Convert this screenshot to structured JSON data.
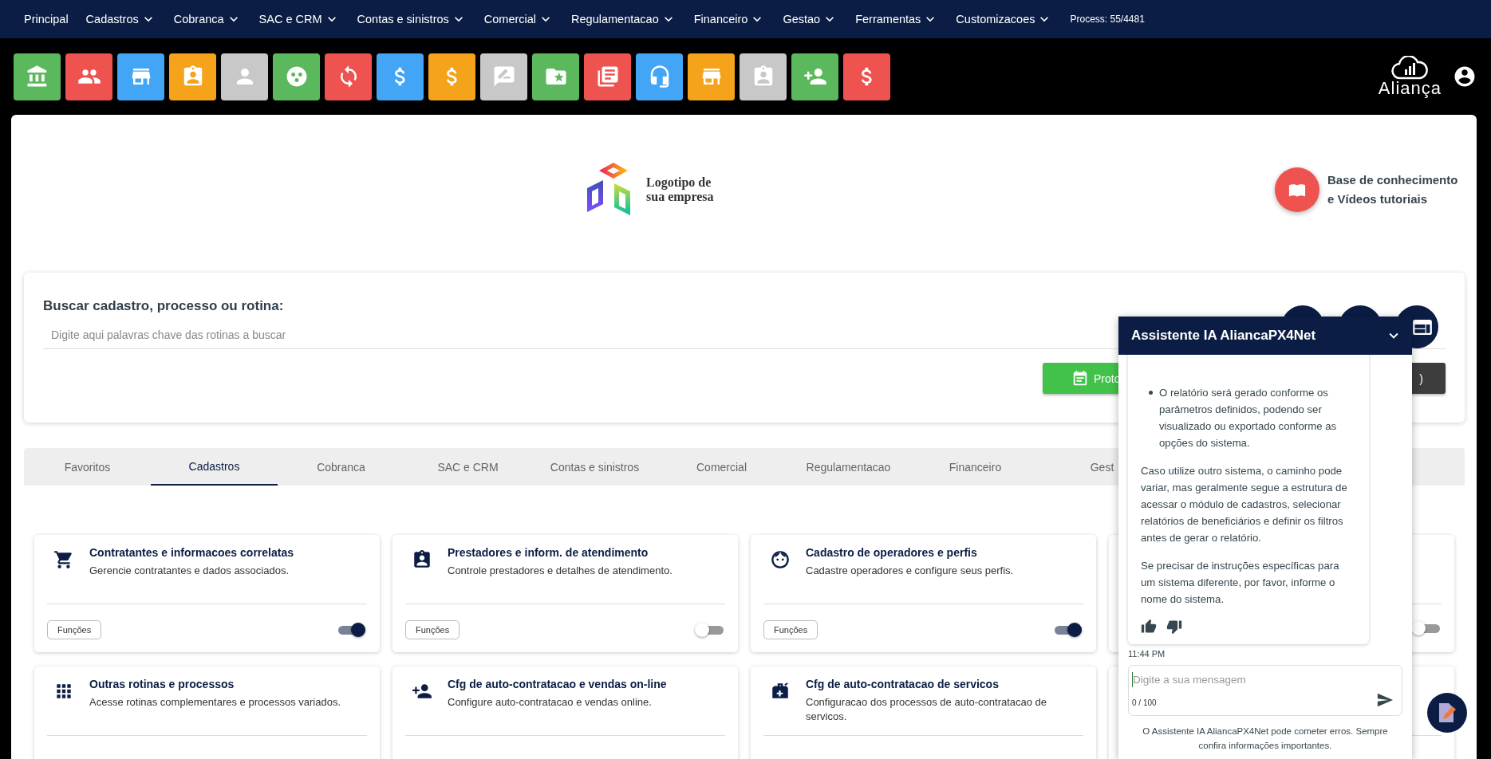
{
  "top_nav": {
    "items": [
      {
        "label": "Principal",
        "dropdown": false
      },
      {
        "label": "Cadastros",
        "dropdown": true
      },
      {
        "label": "Cobranca",
        "dropdown": true
      },
      {
        "label": "SAC e CRM",
        "dropdown": true
      },
      {
        "label": "Contas e sinistros",
        "dropdown": true
      },
      {
        "label": "Comercial",
        "dropdown": true
      },
      {
        "label": "Regulamentacao",
        "dropdown": true
      },
      {
        "label": "Financeiro",
        "dropdown": true
      },
      {
        "label": "Gestao",
        "dropdown": true
      },
      {
        "label": "Ferramentas",
        "dropdown": true
      },
      {
        "label": "Customizacoes",
        "dropdown": true
      }
    ],
    "process": "Process: 55/4481"
  },
  "shortcuts": [
    {
      "color": "#5cb85c"
    },
    {
      "color": "#ef5350"
    },
    {
      "color": "#42a5f5"
    },
    {
      "color": "#f5a31a"
    },
    {
      "color": "#c8c8c8"
    },
    {
      "color": "#5cb85c"
    },
    {
      "color": "#ef5350"
    },
    {
      "color": "#42a5f5"
    },
    {
      "color": "#f5a31a"
    },
    {
      "color": "#c8c8c8"
    },
    {
      "color": "#5cb85c"
    },
    {
      "color": "#ef5350"
    },
    {
      "color": "#42a5f5"
    },
    {
      "color": "#f5a31a"
    },
    {
      "color": "#c8c8c8"
    },
    {
      "color": "#5cb85c"
    },
    {
      "color": "#ef5350"
    }
  ],
  "brand": {
    "name": "Aliança"
  },
  "logo": {
    "text": "Logotipo de sua empresa"
  },
  "knowledge_base": {
    "label": "Base de conhecimento e Vídeos tutoriais"
  },
  "search": {
    "label": "Buscar cadastro, processo ou rotina:",
    "placeholder": "Digite aqui palavras chave das rotinas a buscar",
    "buttons": [
      {
        "label": "Proto",
        "kind": "primary"
      },
      {
        "label": ")",
        "kind": "dark"
      }
    ]
  },
  "tabs": [
    {
      "label": "Favoritos",
      "selected": false
    },
    {
      "label": "Cadastros",
      "selected": true
    },
    {
      "label": "Cobranca",
      "selected": false
    },
    {
      "label": "SAC e CRM",
      "selected": false
    },
    {
      "label": "Contas e sinistros",
      "selected": false
    },
    {
      "label": "Comercial",
      "selected": false
    },
    {
      "label": "Regulamentacao",
      "selected": false
    },
    {
      "label": "Financeiro",
      "selected": false
    },
    {
      "label": "Gest",
      "selected": false
    }
  ],
  "cards": [
    {
      "kind": "feature",
      "title": "Contratantes e informacoes correlatas",
      "description": "Gerencie contratantes e dados associados.",
      "button": "Funções",
      "on": true
    },
    {
      "kind": "feature",
      "title": "Prestadores e inform. de atendimento",
      "description": "Controle prestadores e detalhes de atendimento.",
      "button": "Funções",
      "on": false
    },
    {
      "kind": "feature",
      "title": "Cadastro de operadores e perfis",
      "description": "Cadastre operadores e configure seus perfis.",
      "button": "Funções",
      "on": true
    },
    {
      "kind": "covered",
      "on": false
    },
    {
      "kind": "feature",
      "title": "Outras rotinas e processos",
      "description": "Acesse rotinas complementares e processos variados."
    },
    {
      "kind": "feature",
      "title": "Cfg de auto-contratacao e vendas on-line",
      "description": "Configure auto-contratacao e vendas online."
    },
    {
      "kind": "feature",
      "title": "Cfg de auto-contratacao de servicos",
      "description": "Configuracao dos processos de auto-contratacao de servicos."
    },
    {
      "kind": "covered"
    }
  ],
  "chat": {
    "title": "Assistente IA AliancaPX4Net",
    "bullets": [
      "O relatório será gerado conforme os parâmetros definidos, podendo ser visualizado ou exportado conforme as opções do sistema."
    ],
    "paragraphs": [
      "Caso utilize outro sistema, o caminho pode variar, mas geralmente segue a estrutura de acessar o módulo de cadastros, selecionar relatórios de beneficiários e definir os filtros antes de gerar o relatório.",
      "Se precisar de instruções específicas para um sistema diferente, por favor, informe o nome do sistema."
    ],
    "time": "11:44 PM",
    "input": {
      "placeholder": "Digite a sua mensagem",
      "counter": "0 / 100"
    },
    "disclaimer": "O Assistente IA AliancaPX4Net pode cometer erros. Sempre confira informações importantes."
  }
}
